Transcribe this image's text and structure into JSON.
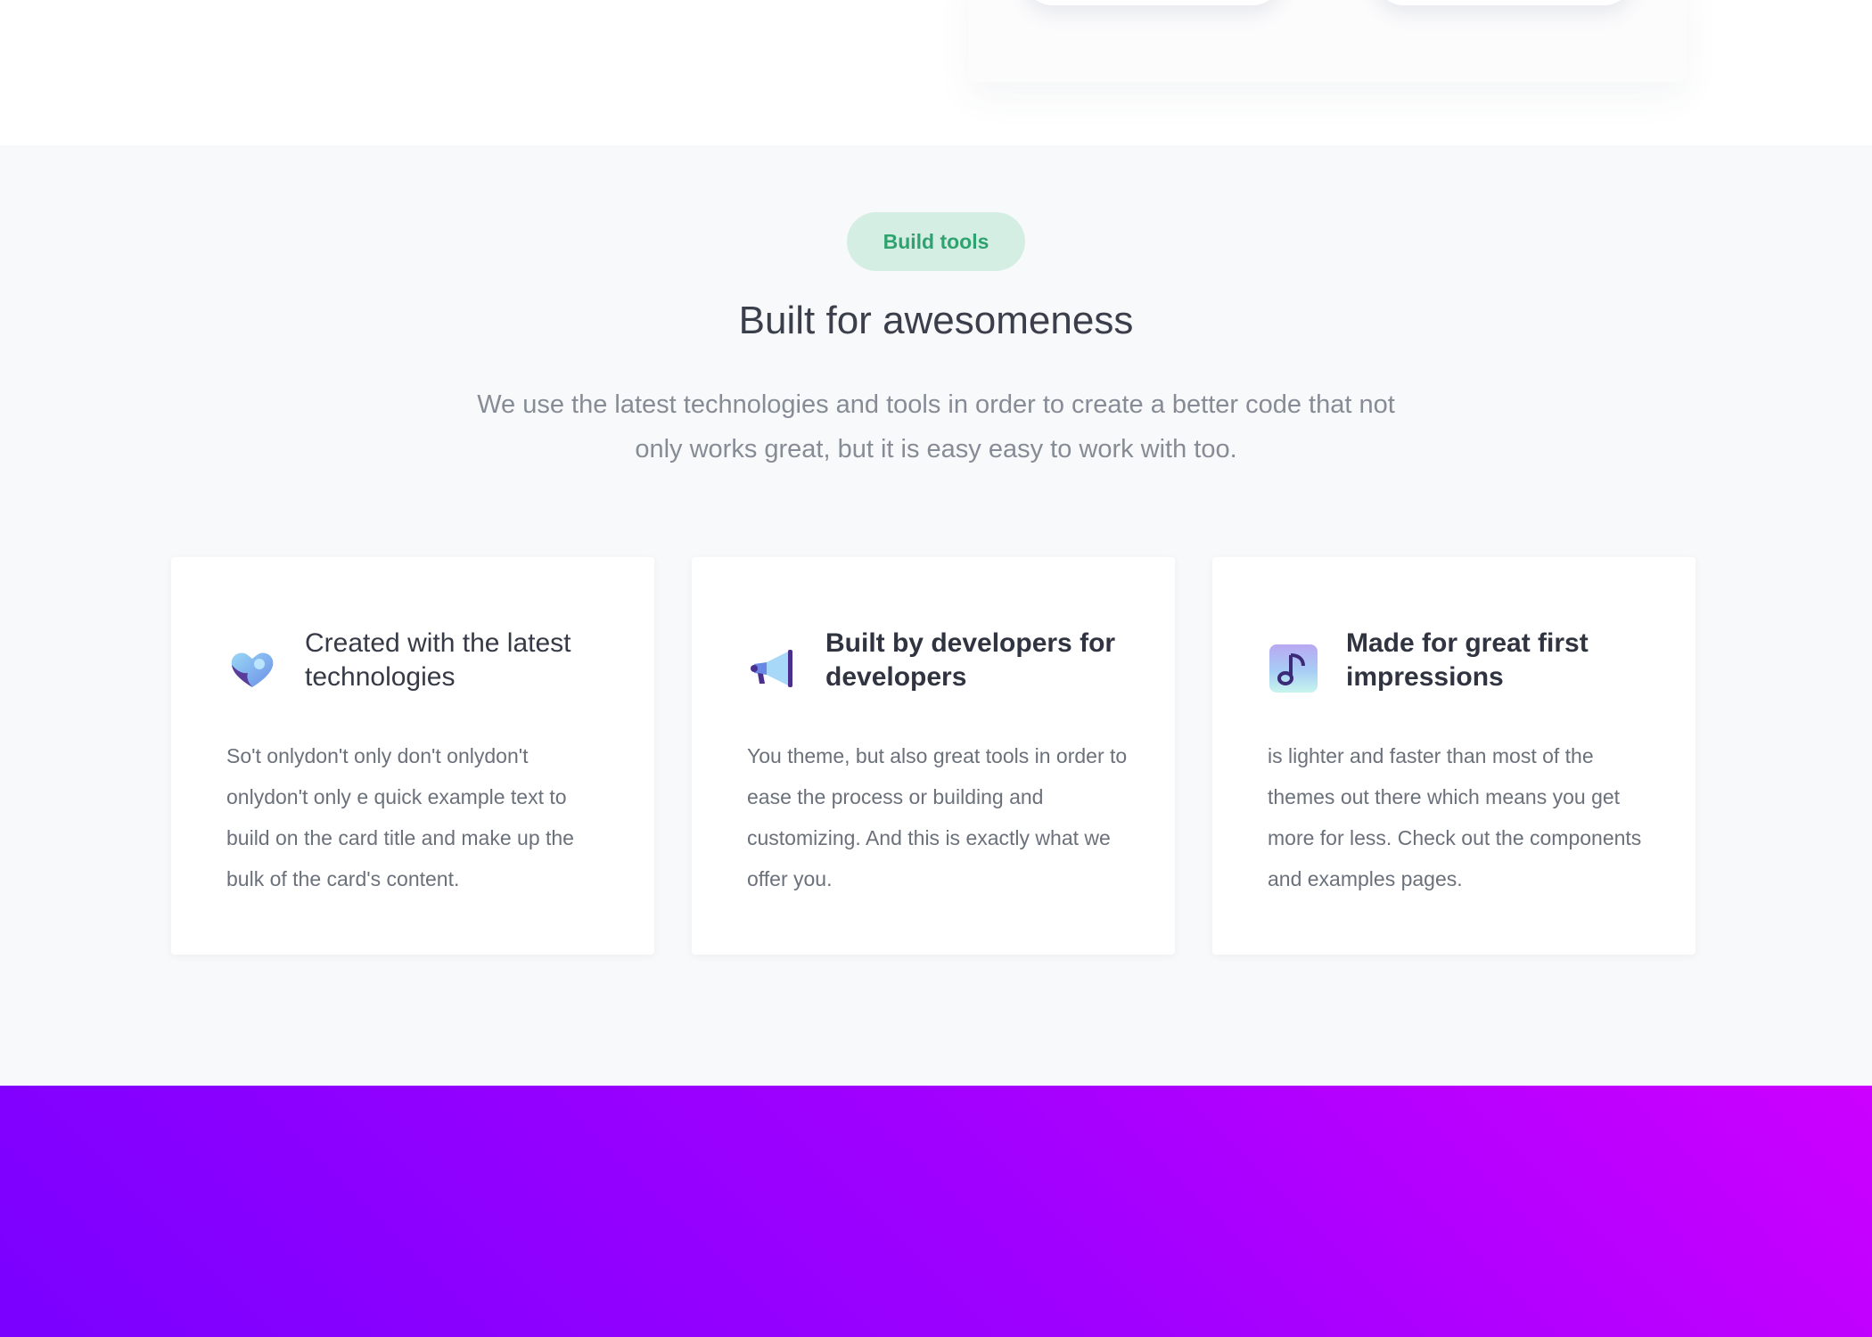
{
  "features": {
    "badge": "Build tools",
    "title": "Built for awesomeness",
    "lead": "We use the latest technologies and tools in order to create a better code that not only works great, but it is easy easy to work with too.",
    "cards": [
      {
        "icon": "heart-icon",
        "title": "Created with the latest technologies",
        "text": "So't onlydon't only don't onlydon't onlydon't only e quick example text to build on the card title and make up the bulk of the card's content."
      },
      {
        "icon": "megaphone-icon",
        "title": "Built by developers for developers",
        "text": "You theme, but also great tools in order to ease the process or building and customizing. And this is exactly what we offer you."
      },
      {
        "icon": "music-note-icon",
        "title": "Made for great first impressions",
        "text": "is lighter and faster than most of the themes out there which means you get more for less. Check out the components and examples pages."
      }
    ]
  },
  "colors": {
    "accent_green": "#2fa36f",
    "badge_bg": "#d4eee3",
    "section_bg": "#f8f9fa",
    "gradient_start": "#7a00ff",
    "gradient_end": "#cc00ff"
  }
}
